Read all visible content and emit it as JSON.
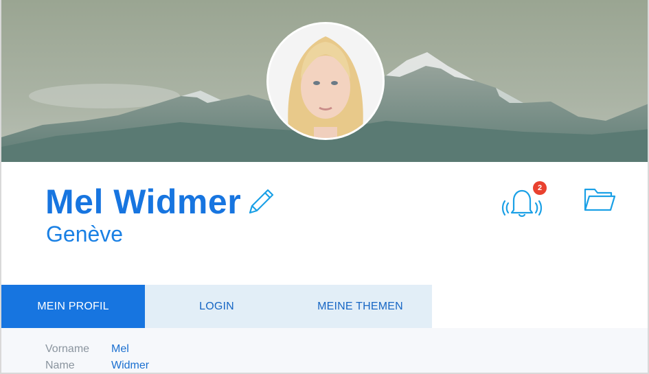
{
  "profile": {
    "name": "Mel Widmer",
    "city": "Genève",
    "notification_count": "2"
  },
  "icons": {
    "edit": "pencil-icon",
    "notifications": "bell-icon",
    "files": "folder-icon"
  },
  "tabs": [
    {
      "label": "MEIN PROFIL",
      "active": true
    },
    {
      "label": "LOGIN",
      "active": false
    },
    {
      "label": "MEINE THEMEN",
      "active": false
    }
  ],
  "details": [
    {
      "label": "Vorname",
      "value": "Mel"
    },
    {
      "label": "Name",
      "value": "Widmer"
    }
  ],
  "colors": {
    "accent": "#1775e0",
    "tab_bar": "#e2eef7",
    "badge": "#e9412f",
    "icon": "#1aa0e6"
  }
}
